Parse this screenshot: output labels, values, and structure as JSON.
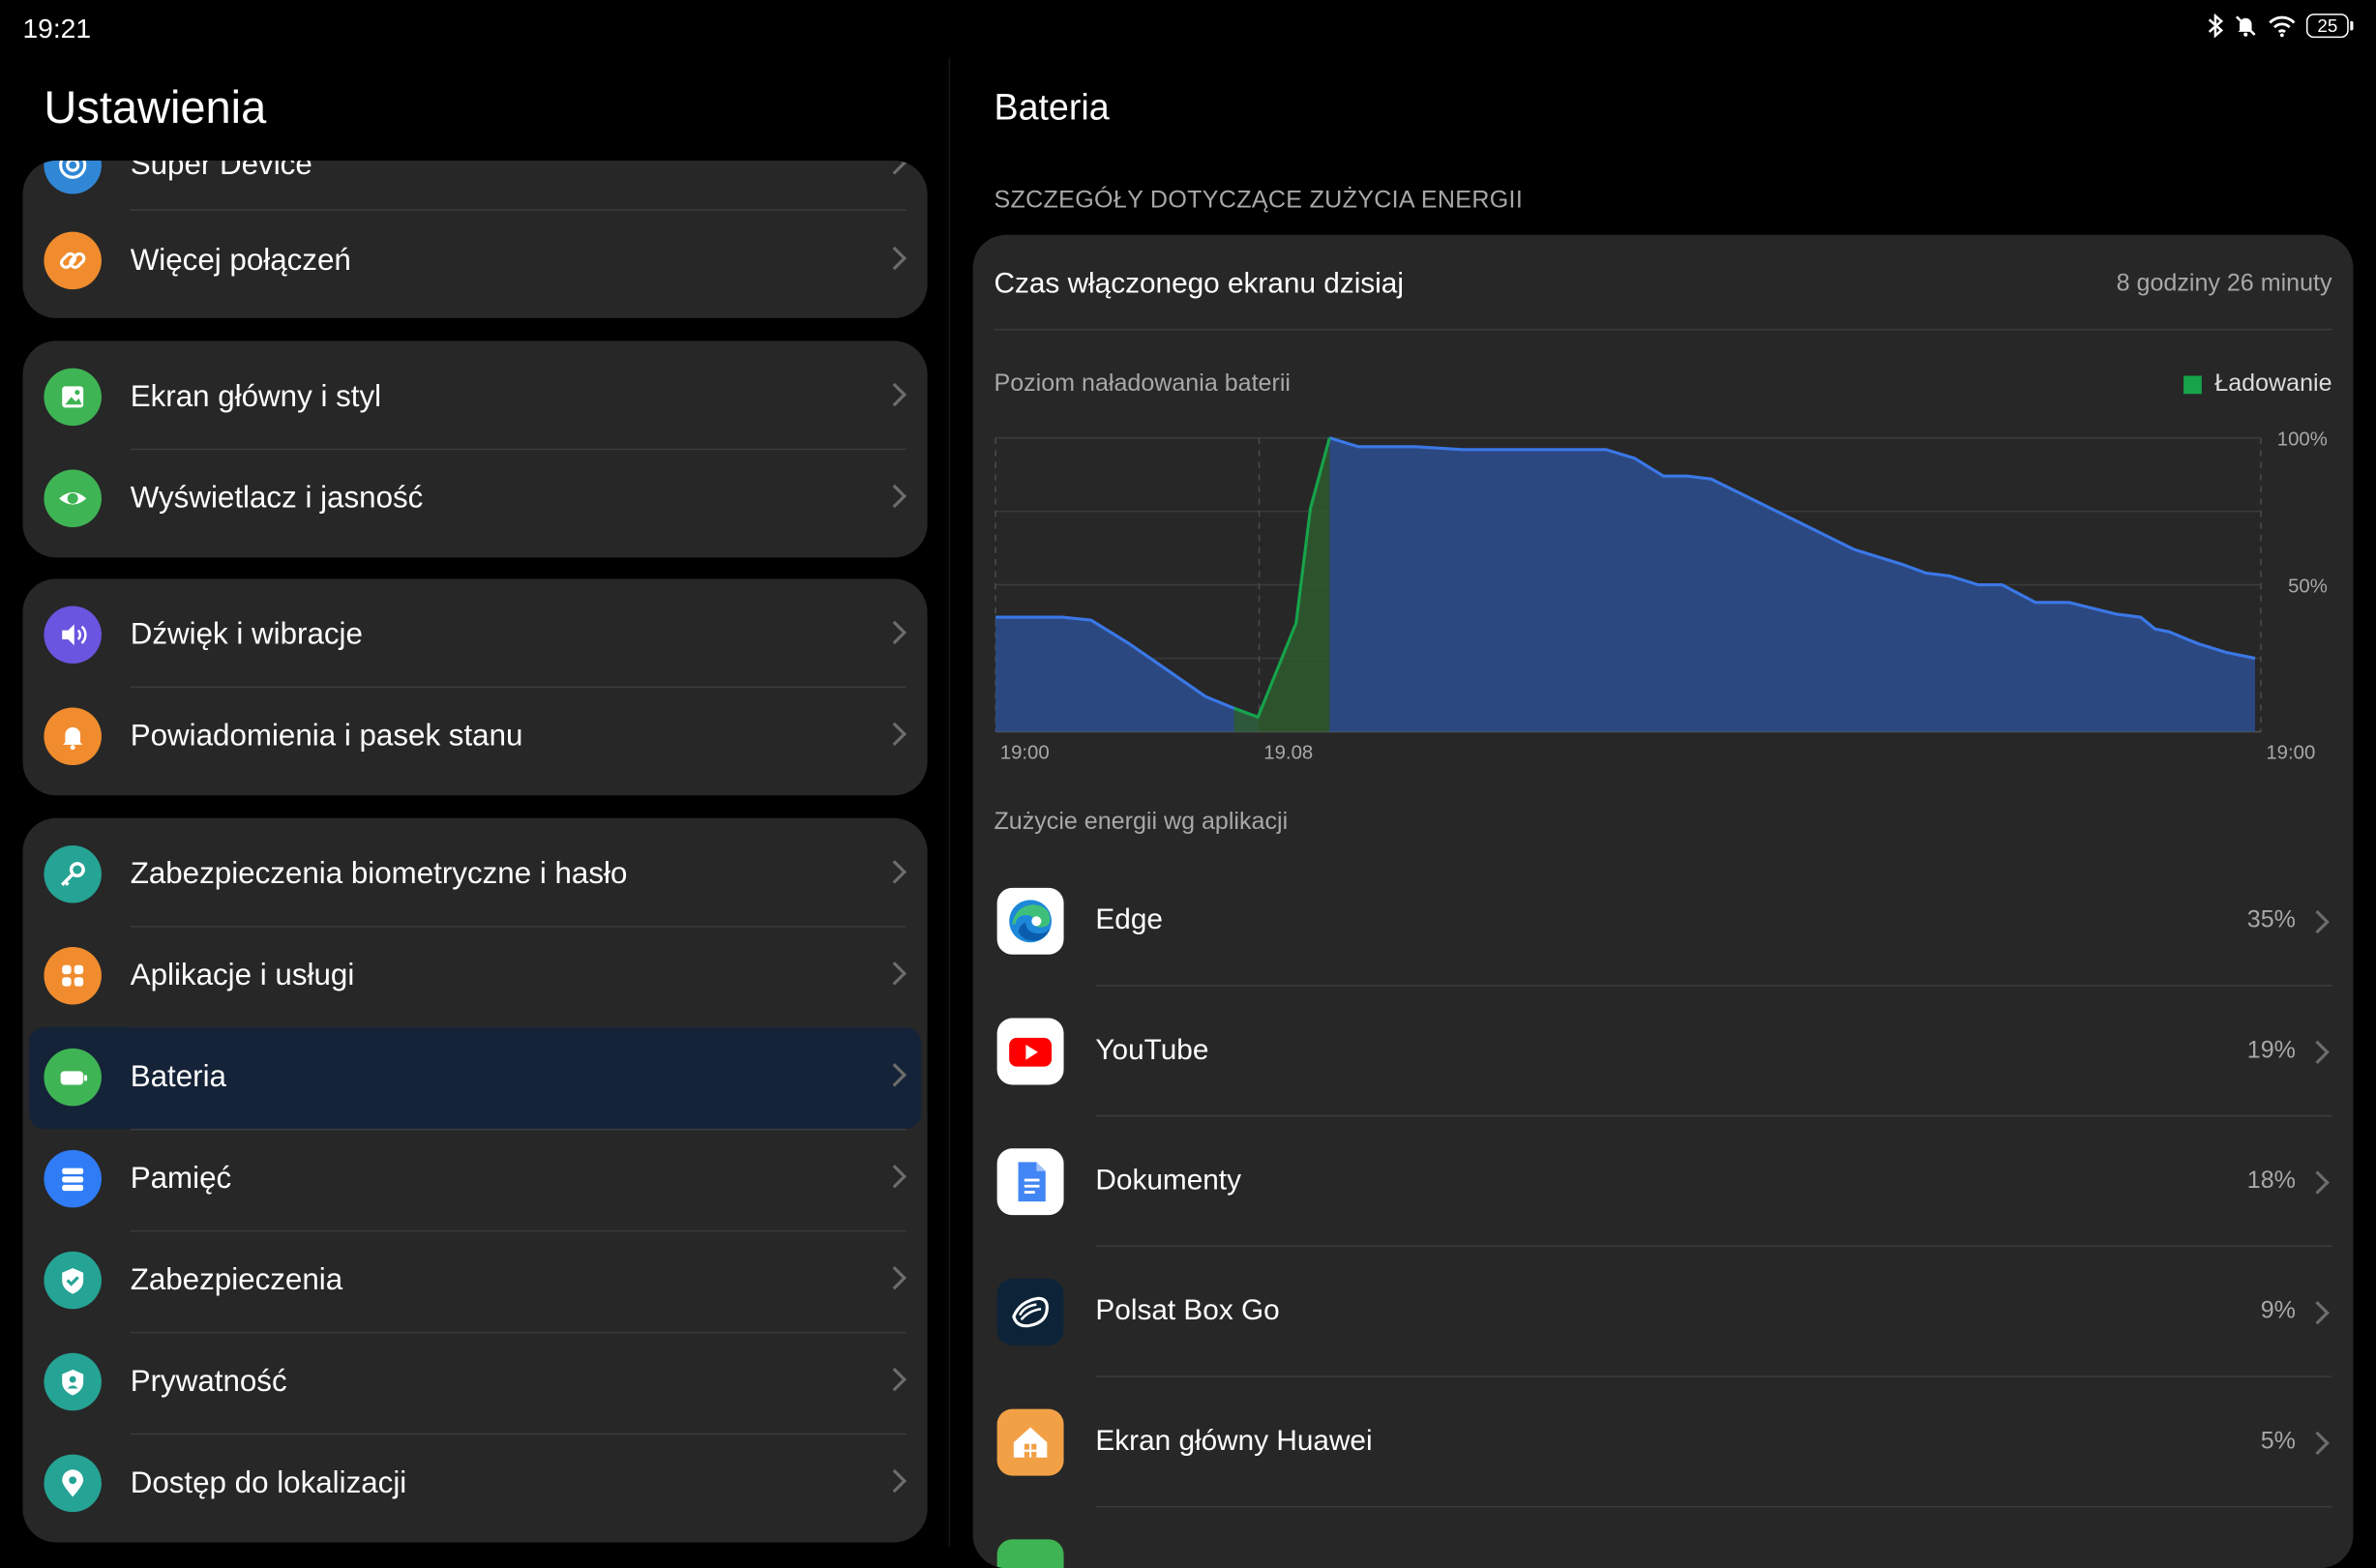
{
  "status_bar": {
    "time": "19:21",
    "battery_level": "25"
  },
  "left": {
    "title": "Ustawienia",
    "groups": [
      {
        "items": [
          {
            "label": "Super Device",
            "icon": "super-device-icon",
            "color": "#2f87d6"
          },
          {
            "label": "Więcej połączeń",
            "icon": "link-icon",
            "color": "#f08c2e"
          }
        ]
      },
      {
        "items": [
          {
            "label": "Ekran główny i styl",
            "icon": "image-icon",
            "color": "#3fb454"
          },
          {
            "label": "Wyświetlacz i jasność",
            "icon": "eye-icon",
            "color": "#3fb454"
          }
        ]
      },
      {
        "items": [
          {
            "label": "Dźwięk i wibracje",
            "icon": "speaker-icon",
            "color": "#6a55e0"
          },
          {
            "label": "Powiadomienia i pasek stanu",
            "icon": "bell-icon",
            "color": "#f08c2e"
          }
        ]
      },
      {
        "items": [
          {
            "label": "Zabezpieczenia biometryczne i hasło",
            "icon": "key-icon",
            "color": "#25a394"
          },
          {
            "label": "Aplikacje i usługi",
            "icon": "apps-grid-icon",
            "color": "#f08c2e"
          },
          {
            "label": "Bateria",
            "icon": "battery-icon",
            "color": "#3fb454",
            "selected": true
          },
          {
            "label": "Pamięć",
            "icon": "storage-icon",
            "color": "#2f7cf6"
          },
          {
            "label": "Zabezpieczenia",
            "icon": "shield-check-icon",
            "color": "#25a394"
          },
          {
            "label": "Prywatność",
            "icon": "privacy-shield-icon",
            "color": "#25a394"
          },
          {
            "label": "Dostęp do lokalizacji",
            "icon": "location-pin-icon",
            "color": "#25a394"
          }
        ]
      }
    ]
  },
  "right": {
    "title": "Bateria",
    "section_header": "SZCZEGÓŁY DOTYCZĄCE ZUŻYCIA ENERGII",
    "screen_time": {
      "label": "Czas włączonego ekranu dzisiaj",
      "value": "8 godziny 26 minuty"
    },
    "chart_title": "Poziom naładowania baterii",
    "legend_label": "Ładowanie",
    "apps_title": "Zużycie energii wg aplikacji",
    "apps": [
      {
        "name": "Edge",
        "percent": "35%",
        "icon": "edge-icon"
      },
      {
        "name": "YouTube",
        "percent": "19%",
        "icon": "youtube-icon"
      },
      {
        "name": "Dokumenty",
        "percent": "18%",
        "icon": "docs-icon"
      },
      {
        "name": "Polsat Box Go",
        "percent": "9%",
        "icon": "polsat-icon"
      },
      {
        "name": "Ekran główny Huawei",
        "percent": "5%",
        "icon": "huawei-home-icon"
      }
    ]
  },
  "chart_data": {
    "type": "area",
    "x_tick_labels": [
      "19:00",
      "19.08",
      "19:00"
    ],
    "y_tick_labels": [
      "100%",
      "50%"
    ],
    "ylim": [
      0,
      100
    ],
    "x_unit": "hours since first tick",
    "xlim": [
      0,
      24
    ],
    "grid": true,
    "legend": "top-right",
    "colors": {
      "discharge": "#3b78e7",
      "charging": "#16a34a",
      "discharge_fill": "#2c4a86",
      "charging_fill": "#2f5c2f"
    },
    "series": [
      {
        "name": "Ładowanie",
        "points": [
          [
            5.0,
            8
          ],
          [
            5.5,
            5
          ],
          [
            6.3,
            37
          ],
          [
            6.6,
            76
          ],
          [
            7.0,
            100
          ]
        ]
      },
      {
        "points": [
          [
            0.0,
            39
          ],
          [
            1.4,
            39
          ],
          [
            2.0,
            38
          ],
          [
            2.8,
            30
          ],
          [
            3.6,
            21
          ],
          [
            4.4,
            12
          ],
          [
            5.0,
            8
          ],
          [
            5.5,
            5
          ]
        ]
      },
      {
        "points": [
          [
            7.0,
            100
          ],
          [
            7.6,
            97
          ],
          [
            8.8,
            97
          ],
          [
            9.8,
            96
          ],
          [
            12.8,
            96
          ],
          [
            13.4,
            93
          ],
          [
            14.0,
            87
          ],
          [
            14.5,
            87
          ],
          [
            15.0,
            86
          ],
          [
            16.5,
            74
          ],
          [
            17.0,
            70
          ],
          [
            17.5,
            66
          ],
          [
            18.0,
            62
          ],
          [
            19.0,
            57
          ],
          [
            19.5,
            54
          ],
          [
            20.0,
            53
          ],
          [
            20.6,
            50
          ],
          [
            21.1,
            50
          ],
          [
            21.8,
            44
          ],
          [
            22.5,
            44
          ],
          [
            23.0,
            42
          ],
          [
            23.5,
            40
          ],
          [
            24.0,
            39
          ],
          [
            24.3,
            35
          ],
          [
            24.6,
            34
          ],
          [
            25.2,
            30
          ],
          [
            25.8,
            27
          ],
          [
            26.4,
            25
          ]
        ]
      }
    ]
  }
}
